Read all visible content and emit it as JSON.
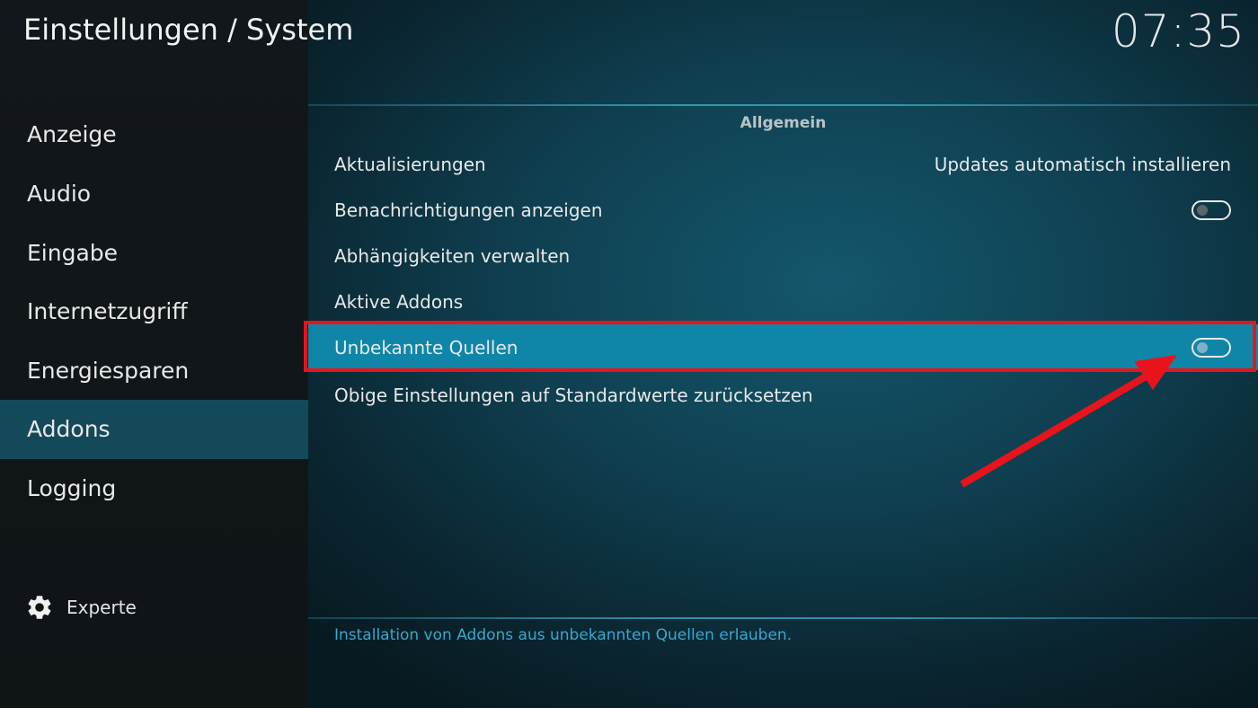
{
  "header": {
    "title": "Einstellungen / System",
    "clock": "07:35"
  },
  "sidebar": {
    "items": [
      {
        "label": "Anzeige"
      },
      {
        "label": "Audio"
      },
      {
        "label": "Eingabe"
      },
      {
        "label": "Internetzugriff"
      },
      {
        "label": "Energiesparen"
      },
      {
        "label": "Addons",
        "active": true
      },
      {
        "label": "Logging"
      }
    ],
    "level": {
      "icon": "gear-icon",
      "label": "Experte"
    }
  },
  "settings": {
    "group_title": "Allgemein",
    "rows": [
      {
        "label": "Aktualisierungen",
        "value": "Updates automatisch installieren"
      },
      {
        "label": "Benachrichtigungen anzeigen",
        "toggle": false
      },
      {
        "label": "Abhängigkeiten verwalten"
      },
      {
        "label": "Aktive Addons"
      },
      {
        "label": "Unbekannte Quellen",
        "toggle": false,
        "focused": true
      },
      {
        "label": "Obige Einstellungen auf Standardwerte zurücksetzen"
      }
    ],
    "description": "Installation von Addons aus unbekannten Quellen erlauben."
  },
  "annotation": {
    "highlight_color": "#e8141b"
  },
  "colors": {
    "accent": "#0f86a8",
    "sidebar_active": "#14495a",
    "description_text": "#3aa7cc"
  }
}
